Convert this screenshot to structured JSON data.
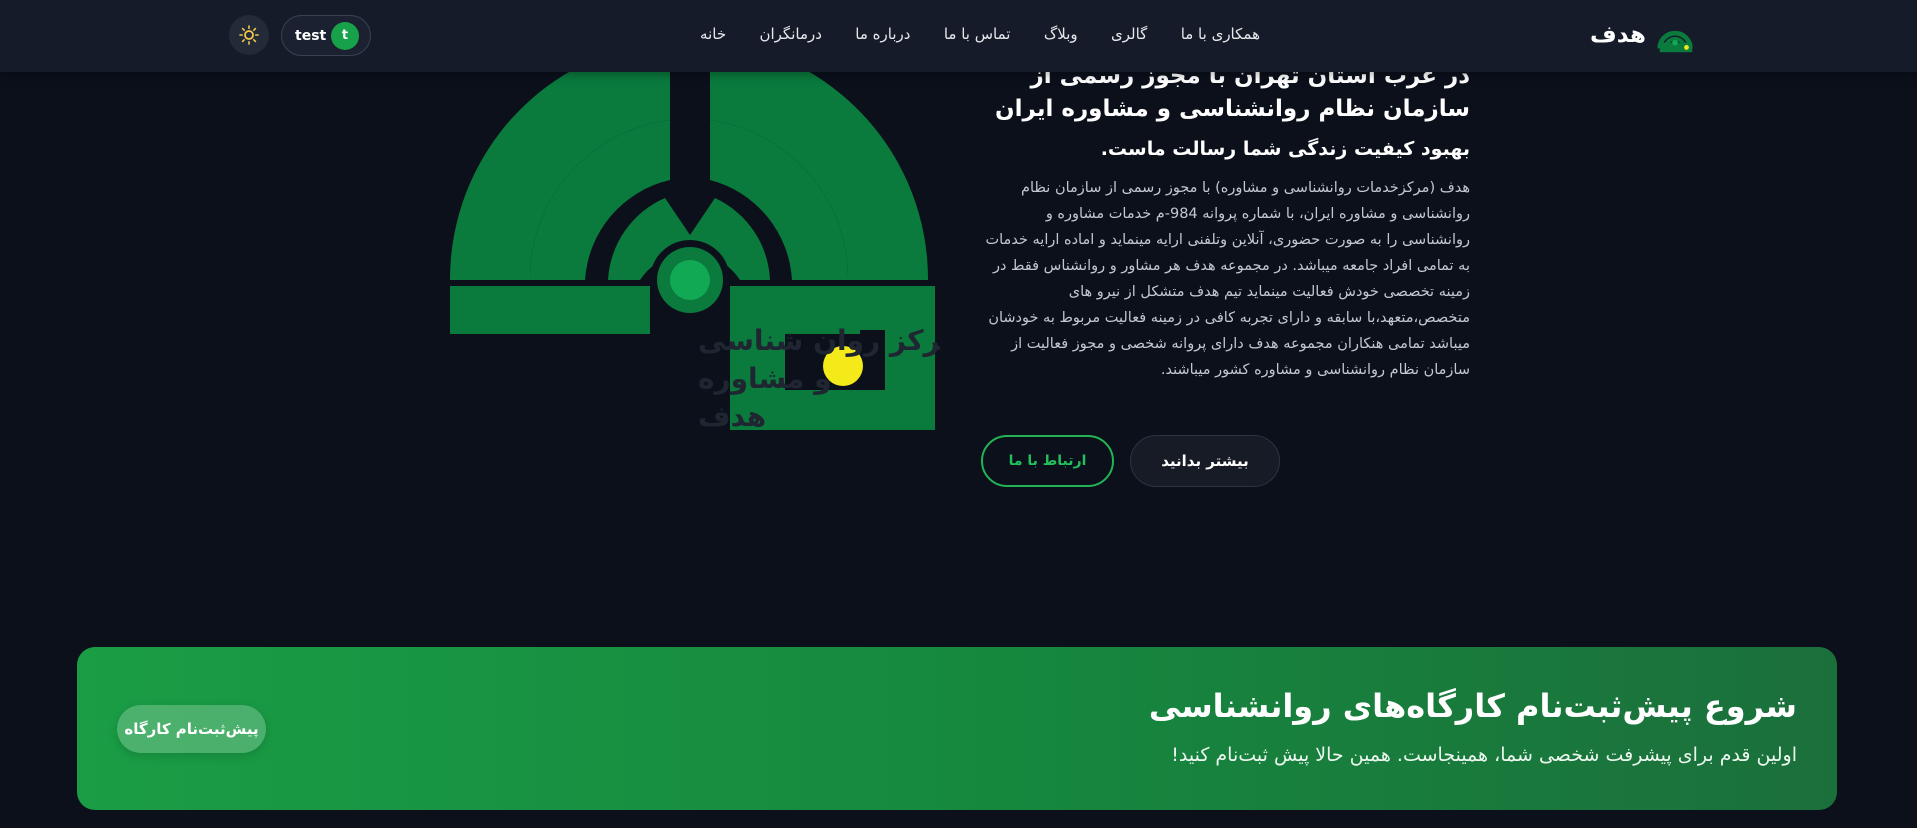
{
  "header": {
    "brand_name": "هدف",
    "nav": [
      "خانه",
      "درمانگران",
      "درباره ما",
      "تماس با ما",
      "وبلاگ",
      "گالری",
      "همکاری با ما"
    ],
    "user": {
      "name": "test",
      "initial": "t"
    }
  },
  "hero": {
    "logo_text_line1": "مرکز روان شناسی",
    "logo_text_line2": "و مشاوره",
    "logo_text_line3": "هدف",
    "heading_line1": "در غرب استان تهران با مجوز رسمی از",
    "heading_line2": "سازمان نظام روانشناسی و مشاوره ایران",
    "subheading": "بهبود کیفیت زندگی شما رسالت ماست.",
    "description": "هدف (مرکزخدمات روانشناسی و مشاوره) با مجوز رسمی از سازمان نظام روانشناسی و مشاوره ایران، با شماره پروانه 984-م خدمات مشاوره و روانشناسی را به صورت حضوری، آنلاین وتلفنی ارایه مینماید و اماده ارایه خدمات به تمامی افراد جامعه میباشد. در مجموعه هدف هر مشاور و روانشناس فقط در زمینه تخصصی خودش فعالیت مینماید تیم هدف متشکل از نیرو های متخصص،متعهد،با سابقه و دارای تجربه کافی در زمینه فعالیت مربوط به خودشان میباشد تمامی هنکاران مجموعه هدف دارای پروانه شخصی و مجوز فعالیت از سازمان نظام روانشناسی و مشاوره کشور میباشند.",
    "btn_more": "بیشتر بدانید",
    "btn_contact": "ارتباط با ما"
  },
  "banner": {
    "title": "شروع پیش‌ثبت‌نام کارگاه‌های روانشناسی",
    "subtitle": "اولین قدم برای پیشرفت شخصی شما، همینجاست. همین حالا پیش ثبت‌نام کنید!",
    "button": "پیش‌ثبت‌نام کارگاه"
  },
  "colors": {
    "background": "#0b101b",
    "header": "#151b28",
    "accent_green": "#22b454",
    "logo_green": "#0a7a3d",
    "logo_yellow": "#f4ea1a"
  }
}
